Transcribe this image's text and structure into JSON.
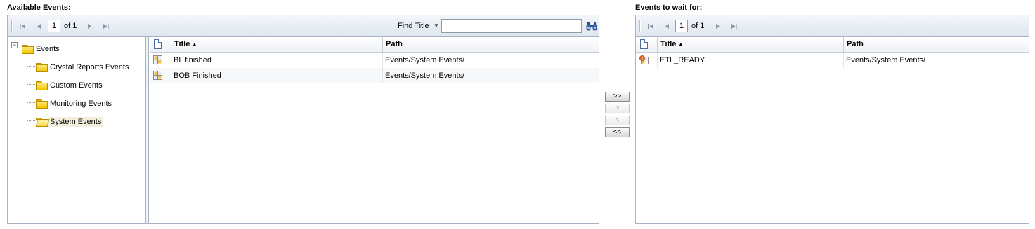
{
  "available": {
    "title": "Available Events:",
    "pager": {
      "page": "1",
      "of_text": "of 1"
    },
    "find": {
      "label": "Find Title",
      "value": ""
    },
    "tree": {
      "root": "Events",
      "children": [
        "Crystal Reports Events",
        "Custom Events",
        "Monitoring Events",
        "System Events"
      ],
      "selected": "System Events"
    },
    "columns": {
      "title": "Title",
      "path": "Path"
    },
    "rows": [
      {
        "title": "BL finished",
        "path": "Events/System Events/"
      },
      {
        "title": "BOB Finished",
        "path": "Events/System Events/"
      }
    ]
  },
  "transfer": {
    "add_all": ">>",
    "add": ">",
    "remove": "<",
    "remove_all": "<<"
  },
  "waiting": {
    "title": "Events to wait for:",
    "pager": {
      "page": "1",
      "of_text": "of 1"
    },
    "columns": {
      "title": "Title",
      "path": "Path"
    },
    "rows": [
      {
        "title": "ETL_READY",
        "path": "Events/System Events/"
      }
    ]
  },
  "icons": {
    "first": "first-page-icon",
    "prev": "previous-page-icon",
    "next": "next-page-icon",
    "last": "last-page-icon",
    "find": "binoculars-icon",
    "folder": "folder-icon",
    "event": "event-icon",
    "doc": "document-icon"
  },
  "colors": {
    "border": "#a9b4c2",
    "toolbar": "#dfe6ef",
    "selected": "#f2f0dd"
  }
}
